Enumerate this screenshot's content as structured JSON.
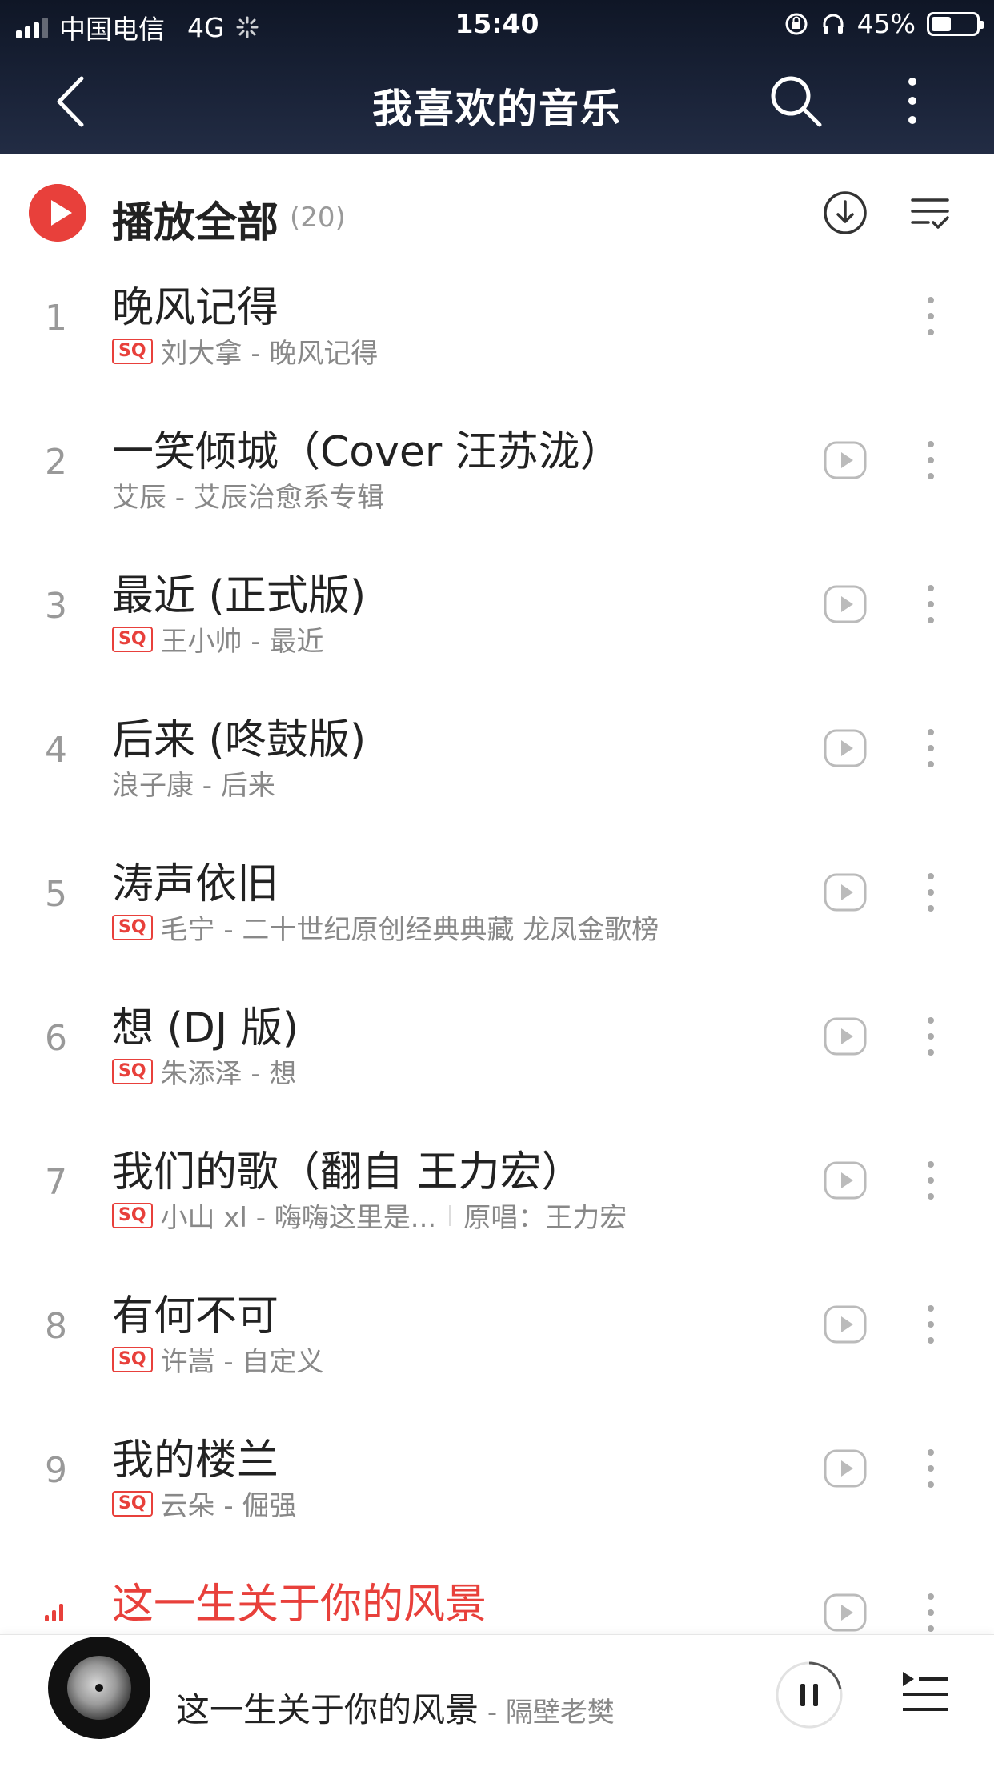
{
  "status_bar": {
    "carrier": "中国电信",
    "network": "4G",
    "time": "15:40",
    "battery": "45%"
  },
  "nav": {
    "title": "我喜欢的音乐"
  },
  "play_all": {
    "label": "播放全部",
    "count": "(20)"
  },
  "colors": {
    "accent": "#e8403b",
    "header_bg": "#1a2338"
  },
  "songs": [
    {
      "index": "1",
      "title": "晚风记得",
      "sq": true,
      "subtitle": "刘大拿 - 晚风记得",
      "extra": "",
      "show_play": false
    },
    {
      "index": "2",
      "title": "一笑倾城（Cover 汪苏泷）",
      "sq": false,
      "subtitle": "艾辰 - 艾辰治愈系专辑",
      "extra": "",
      "show_play": true
    },
    {
      "index": "3",
      "title": "最近 (正式版)",
      "sq": true,
      "subtitle": "王小帅 - 最近",
      "extra": "",
      "show_play": true
    },
    {
      "index": "4",
      "title": "后来 (咚鼓版)",
      "sq": false,
      "subtitle": "浪子康 - 后来",
      "extra": "",
      "show_play": true
    },
    {
      "index": "5",
      "title": "涛声依旧",
      "sq": true,
      "subtitle": "毛宁 - 二十世纪原创经典典藏 龙凤金歌榜",
      "extra": "",
      "show_play": true
    },
    {
      "index": "6",
      "title": "想 (DJ 版)",
      "sq": true,
      "subtitle": "朱添泽 - 想",
      "extra": "",
      "show_play": true
    },
    {
      "index": "7",
      "title": "我们的歌（翻自 王力宏）",
      "sq": true,
      "subtitle": "小山 xl - 嗨嗨这里是...",
      "extra": "原唱：王力宏",
      "show_play": true
    },
    {
      "index": "8",
      "title": "有何不可",
      "sq": true,
      "subtitle": "许嵩 - 自定义",
      "extra": "",
      "show_play": true
    },
    {
      "index": "9",
      "title": "我的楼兰",
      "sq": true,
      "subtitle": "云朵 - 倔强",
      "extra": "",
      "show_play": true
    },
    {
      "index": "",
      "title": "这一生关于你的风景",
      "sq": false,
      "subtitle": "",
      "extra": "",
      "show_play": true,
      "playing": true
    }
  ],
  "now_playing": {
    "title": "这一生关于你的风景",
    "separator": " - ",
    "artist": "隔壁老樊"
  },
  "icons": {
    "back": "chevron-left-icon",
    "search": "search-icon",
    "more": "more-vertical-icon",
    "play_all": "play-circle-icon",
    "download": "download-icon",
    "multi_select": "multi-select-icon",
    "row_play": "play-outline-icon",
    "pause": "pause-icon",
    "playlist": "playlist-icon"
  }
}
